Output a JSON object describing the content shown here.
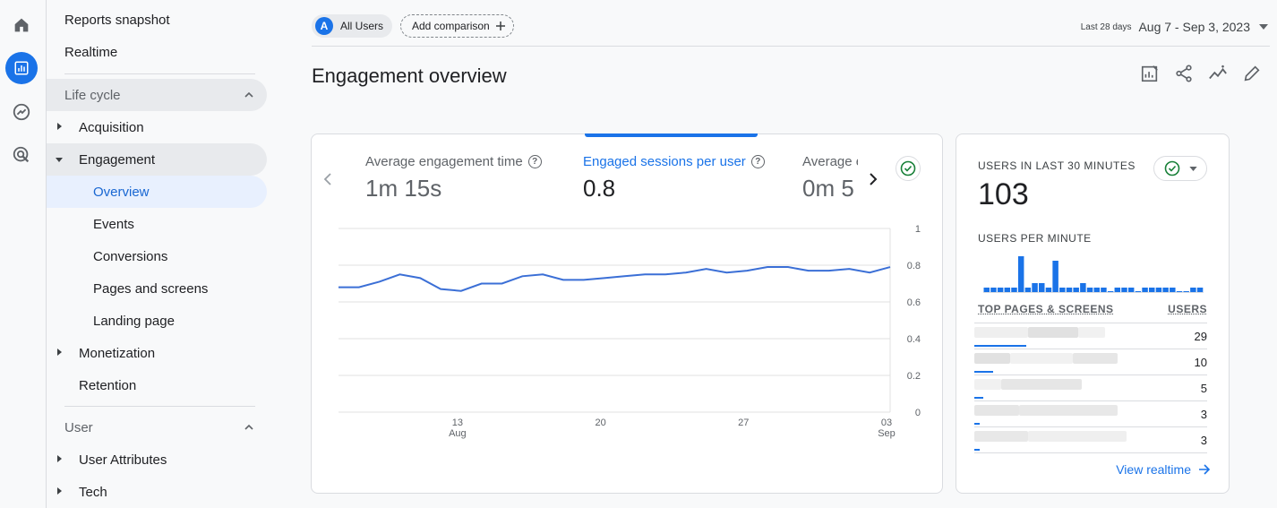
{
  "colors": {
    "accent": "#1a73e8",
    "line": "#3b6fd6",
    "grid": "#e0e0e0"
  },
  "rail": [
    {
      "name": "home-icon"
    },
    {
      "name": "reports-icon",
      "active": true
    },
    {
      "name": "explore-icon"
    },
    {
      "name": "advertising-icon"
    }
  ],
  "nav": {
    "reports_snapshot": "Reports snapshot",
    "realtime": "Realtime",
    "lifecycle": "Life cycle",
    "acquisition": "Acquisition",
    "engagement": "Engagement",
    "overview": "Overview",
    "events": "Events",
    "conversions": "Conversions",
    "pages_and_screens": "Pages and screens",
    "landing_page": "Landing page",
    "monetization": "Monetization",
    "retention": "Retention",
    "user": "User",
    "user_attributes": "User Attributes",
    "tech": "Tech"
  },
  "topbar": {
    "segment_avatar": "A",
    "segment": "All Users",
    "add_comparison": "Add comparison",
    "date_label": "Last 28 days",
    "date_range": "Aug 7 - Sep 3, 2023"
  },
  "page": {
    "title": "Engagement overview"
  },
  "metrics": [
    {
      "label": "Average engagement time",
      "value": "1m 15s"
    },
    {
      "label": "Engaged sessions per user",
      "value": "0.8"
    },
    {
      "label": "Average e",
      "value": "0m 5"
    }
  ],
  "chart_data": {
    "type": "line",
    "x": [
      "Aug 7",
      "Aug 8",
      "Aug 9",
      "Aug 10",
      "Aug 11",
      "Aug 12",
      "Aug 13",
      "Aug 14",
      "Aug 15",
      "Aug 16",
      "Aug 17",
      "Aug 18",
      "Aug 19",
      "Aug 20",
      "Aug 21",
      "Aug 22",
      "Aug 23",
      "Aug 24",
      "Aug 25",
      "Aug 26",
      "Aug 27",
      "Aug 28",
      "Aug 29",
      "Aug 30",
      "Aug 31",
      "Sep 1",
      "Sep 2",
      "Sep 3"
    ],
    "series": [
      {
        "values": [
          0.68,
          0.68,
          0.71,
          0.75,
          0.73,
          0.67,
          0.66,
          0.7,
          0.7,
          0.74,
          0.75,
          0.72,
          0.72,
          0.73,
          0.74,
          0.75,
          0.75,
          0.76,
          0.78,
          0.76,
          0.77,
          0.79,
          0.79,
          0.77,
          0.77,
          0.78,
          0.76,
          0.79
        ]
      }
    ],
    "y_ticks": [
      "1",
      "0.8",
      "0.6",
      "0.4",
      "0.2",
      "0"
    ],
    "x_ticks": [
      {
        "day": "13",
        "month": "Aug"
      },
      {
        "day": "20",
        "month": ""
      },
      {
        "day": "27",
        "month": ""
      },
      {
        "day": "03",
        "month": "Sep"
      }
    ],
    "ylim": [
      0,
      1
    ],
    "grid": true
  },
  "realtime": {
    "users_label": "USERS IN LAST 30 MINUTES",
    "users_value": "103",
    "per_minute_label": "USERS PER MINUTE",
    "per_minute": [
      1,
      1,
      1,
      1,
      1,
      8,
      1,
      2,
      2,
      1,
      7,
      1,
      1,
      1,
      2,
      1,
      1,
      1,
      0,
      1,
      1,
      1,
      0,
      1,
      1,
      1,
      1,
      1,
      0,
      0,
      1,
      1
    ],
    "table_header_pages": "TOP PAGES & SCREENS",
    "table_header_users": "USERS",
    "rows": [
      {
        "users": "29",
        "share": 1.0
      },
      {
        "users": "10",
        "share": 0.36
      },
      {
        "users": "5",
        "share": 0.18
      },
      {
        "users": "3",
        "share": 0.1
      },
      {
        "users": "3",
        "share": 0.1
      }
    ],
    "view_realtime": "View realtime"
  }
}
